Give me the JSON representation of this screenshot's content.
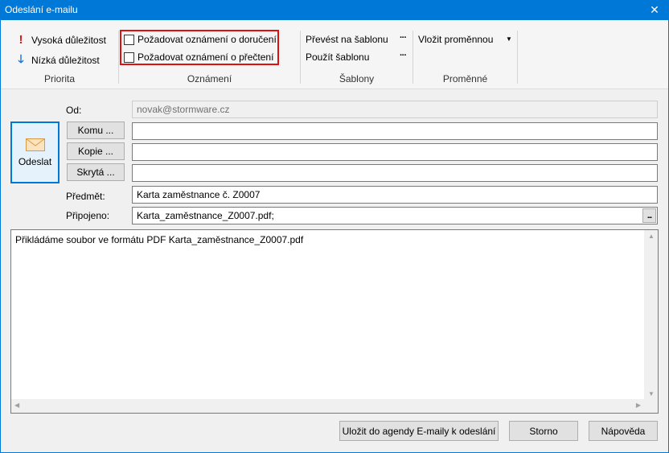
{
  "window": {
    "title": "Odeslání e-mailu",
    "close_glyph": "✕"
  },
  "ribbon": {
    "priority": {
      "high_label": "Vysoká důležitost",
      "low_label": "Nízká důležitost",
      "group_label": "Priorita",
      "high_icon": "exclamation-icon",
      "low_icon": "arrow-down-icon"
    },
    "notifications": {
      "delivery_label": "Požadovat oznámení o doručení",
      "read_label": "Požadovat oznámení o přečtení",
      "delivery_checked": false,
      "read_checked": false,
      "group_label": "Oznámení"
    },
    "templates": {
      "convert_label": "Převést na šablonu",
      "use_label": "Použít šablonu",
      "more_glyph": "···",
      "group_label": "Šablony"
    },
    "variables": {
      "insert_label": "Vložit proměnnou",
      "caret_glyph": "▼",
      "group_label": "Proměnné"
    }
  },
  "form": {
    "from_label": "Od:",
    "from_value": "novak@stormware.cz",
    "to_button": "Komu ...",
    "to_value": "",
    "cc_button": "Kopie ...",
    "cc_value": "",
    "bcc_button": "Skrytá ...",
    "bcc_value": "",
    "subject_label": "Předmět:",
    "subject_value": "Karta zaměstnance č. Z0007",
    "attached_label": "Připojeno:",
    "attached_value": "Karta_zaměstnance_Z0007.pdf;",
    "attach_browse": "...",
    "send_label": "Odeslat",
    "send_icon": "envelope-icon"
  },
  "message": {
    "body": "Přikládáme soubor ve formátu PDF Karta_zaměstnance_Z0007.pdf"
  },
  "footer": {
    "save_button": "Uložit do agendy E-maily k odeslání",
    "cancel_button": "Storno",
    "help_button": "Nápověda"
  },
  "colors": {
    "titlebar": "#0078d7",
    "highlight": "#e01010",
    "high_priority": "#d31d1d",
    "low_priority": "#1a6fd6"
  }
}
